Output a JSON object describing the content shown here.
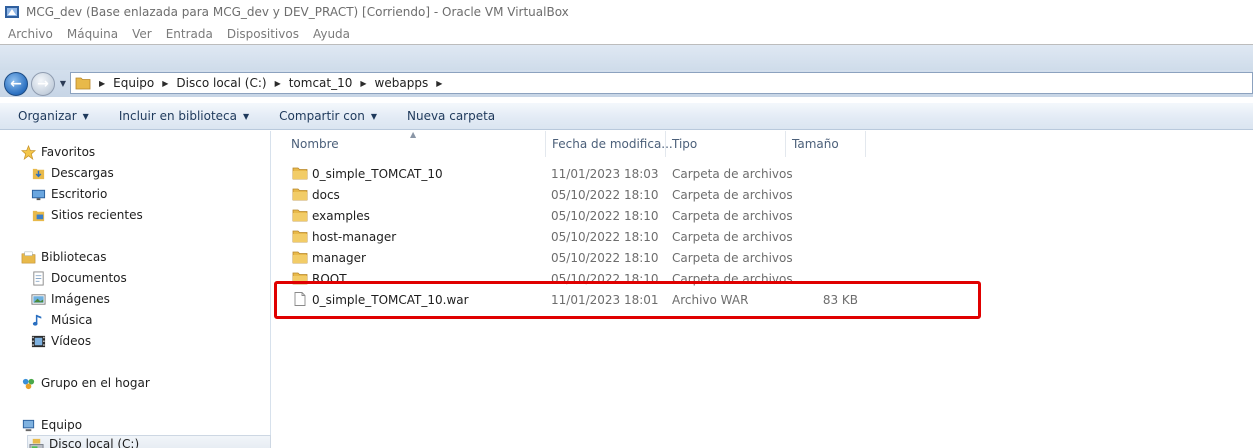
{
  "vbox": {
    "title": "MCG_dev (Base enlazada para MCG_dev y DEV_PRACT) [Corriendo] - Oracle VM VirtualBox",
    "menu": [
      "Archivo",
      "Máquina",
      "Ver",
      "Entrada",
      "Dispositivos",
      "Ayuda"
    ]
  },
  "address": {
    "crumbs": [
      "Equipo",
      "Disco local (C:)",
      "tomcat_10",
      "webapps"
    ]
  },
  "toolbar": {
    "organize": "Organizar",
    "include": "Incluir en biblioteca",
    "share": "Compartir con",
    "new_folder": "Nueva carpeta"
  },
  "nav": {
    "favorites": "Favoritos",
    "downloads": "Descargas",
    "desktop": "Escritorio",
    "recent": "Sitios recientes",
    "libraries": "Bibliotecas",
    "documents": "Documentos",
    "images": "Imágenes",
    "music": "Música",
    "videos": "Vídeos",
    "homegroup": "Grupo en el hogar",
    "computer": "Equipo",
    "local_disk": "Disco local (C:)"
  },
  "columns": {
    "name": "Nombre",
    "date": "Fecha de modifica...",
    "type": "Tipo",
    "size": "Tamaño"
  },
  "files": [
    {
      "name": "0_simple_TOMCAT_10",
      "date": "11/01/2023 18:03",
      "type": "Carpeta de archivos",
      "size": "",
      "icon": "folder-icon"
    },
    {
      "name": "docs",
      "date": "05/10/2022 18:10",
      "type": "Carpeta de archivos",
      "size": "",
      "icon": "folder-icon"
    },
    {
      "name": "examples",
      "date": "05/10/2022 18:10",
      "type": "Carpeta de archivos",
      "size": "",
      "icon": "folder-icon"
    },
    {
      "name": "host-manager",
      "date": "05/10/2022 18:10",
      "type": "Carpeta de archivos",
      "size": "",
      "icon": "folder-icon"
    },
    {
      "name": "manager",
      "date": "05/10/2022 18:10",
      "type": "Carpeta de archivos",
      "size": "",
      "icon": "folder-icon"
    },
    {
      "name": "ROOT",
      "date": "05/10/2022 18:10",
      "type": "Carpeta de archivos",
      "size": "",
      "icon": "folder-icon"
    },
    {
      "name": "0_simple_TOMCAT_10.war",
      "date": "11/01/2023 18:01",
      "type": "Archivo WAR",
      "size": "83 KB",
      "icon": "file-icon"
    }
  ],
  "colors": {
    "highlight": "#e00000",
    "folder": "#e8b94a",
    "toolbar_text": "#1e395b"
  }
}
